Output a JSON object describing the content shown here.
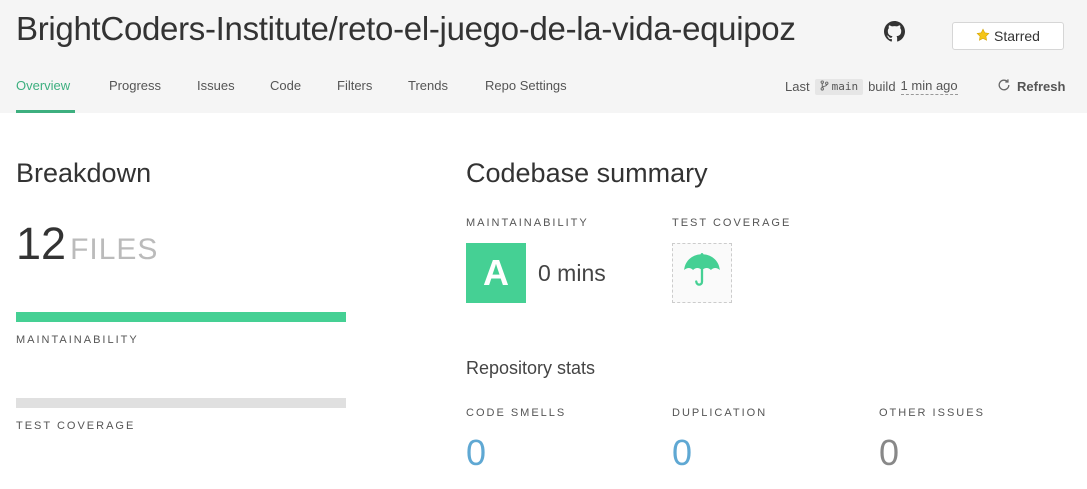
{
  "header": {
    "repo_title": "BrightCoders-Institute/reto-el-juego-de-la-vida-equipoz",
    "star_label": "Starred",
    "tabs": [
      {
        "label": "Overview",
        "active": true
      },
      {
        "label": "Progress",
        "active": false
      },
      {
        "label": "Issues",
        "active": false
      },
      {
        "label": "Code",
        "active": false
      },
      {
        "label": "Filters",
        "active": false
      },
      {
        "label": "Trends",
        "active": false
      },
      {
        "label": "Repo Settings",
        "active": false
      }
    ],
    "last_label": "Last",
    "branch": "main",
    "build_label": "build",
    "build_time": "1 min ago",
    "refresh_label": "Refresh"
  },
  "breakdown": {
    "title": "Breakdown",
    "file_count": "12",
    "file_unit": "FILES",
    "maintainability_label": "MAINTAINABILITY",
    "test_coverage_label": "TEST COVERAGE"
  },
  "summary": {
    "title": "Codebase summary",
    "maintainability_label": "MAINTAINABILITY",
    "grade": "A",
    "grade_time": "0 mins",
    "test_coverage_label": "TEST COVERAGE",
    "repo_stats_title": "Repository stats",
    "stats": [
      {
        "label": "CODE SMELLS",
        "value": "0"
      },
      {
        "label": "DUPLICATION",
        "value": "0"
      },
      {
        "label": "OTHER ISSUES",
        "value": "0"
      }
    ]
  },
  "colors": {
    "accent": "#3daf7f",
    "grade_a": "#45d094",
    "link_value": "#5fa8d3",
    "muted_value": "#888888",
    "bar_maintainability": "#45d094",
    "bar_coverage": "#e0e0e0",
    "star": "#f5c518"
  },
  "icons": {
    "github": "github-icon",
    "star": "star-icon",
    "branch": "branch-icon",
    "refresh": "refresh-icon",
    "umbrella": "umbrella-icon"
  }
}
